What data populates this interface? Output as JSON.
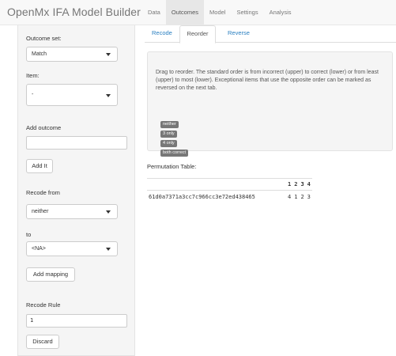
{
  "app": {
    "title": "OpenMx IFA Model Builder"
  },
  "nav": {
    "tabs": [
      "Data",
      "Outcomes",
      "Model",
      "Settings",
      "Analysis"
    ],
    "active": "Outcomes"
  },
  "sidebar": {
    "outcome_set_label": "Outcome set:",
    "outcome_set_value": "Match",
    "item_label": "Item:",
    "item_value": "-",
    "add_outcome_label": "Add outcome",
    "add_outcome_value": "",
    "add_button": "Add It",
    "recode_from_label": "Recode from",
    "recode_from_value": "neither",
    "to_label": "to",
    "to_value": "<NA>",
    "add_mapping_button": "Add mapping",
    "recode_rule_label": "Recode Rule",
    "recode_rule_value": "1",
    "discard_button": "Discard"
  },
  "subtabs": {
    "items": [
      "Recode",
      "Reorder",
      "Reverse"
    ],
    "active": "Reorder"
  },
  "reorder": {
    "instructions": "Drag to reorder. The standard order is from incorrect (upper) to correct (lower) or from least (upper) to most (lower). Exceptional items that use the opposite order can be marked as reversed on the next tab.",
    "outcomes": [
      "neither",
      "3 only",
      "4 only",
      "both correct"
    ]
  },
  "permutation": {
    "title": "Permutation Table:",
    "headers": [
      "",
      "1",
      "2",
      "3",
      "4"
    ],
    "rows": [
      [
        "61d0a7371a3cc7c966cc3e72ed438465",
        "4",
        "1",
        "2",
        "3"
      ]
    ]
  },
  "colors": {
    "accent": "#2a7fc1",
    "badge": "#777777",
    "well": "#f5f5f5"
  }
}
